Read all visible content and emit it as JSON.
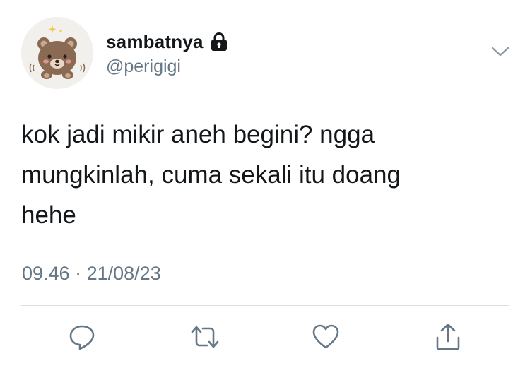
{
  "tweet": {
    "display_name": "sambatnya",
    "handle": "@perigigi",
    "text": "kok jadi mikir aneh begini? ngga\nmungkinlah, cuma sekali itu doang\nhehe",
    "time": "09.46",
    "separator": "·",
    "date": "21/08/23"
  },
  "icons": {
    "avatar": "bear-avatar",
    "locked": "lock-icon",
    "menu": "chevron-down-icon",
    "actions": [
      "reply-icon",
      "retweet-icon",
      "like-icon",
      "share-icon"
    ]
  },
  "colors": {
    "text": "#14171a",
    "secondary": "#657786",
    "divider": "#d9dee2"
  }
}
